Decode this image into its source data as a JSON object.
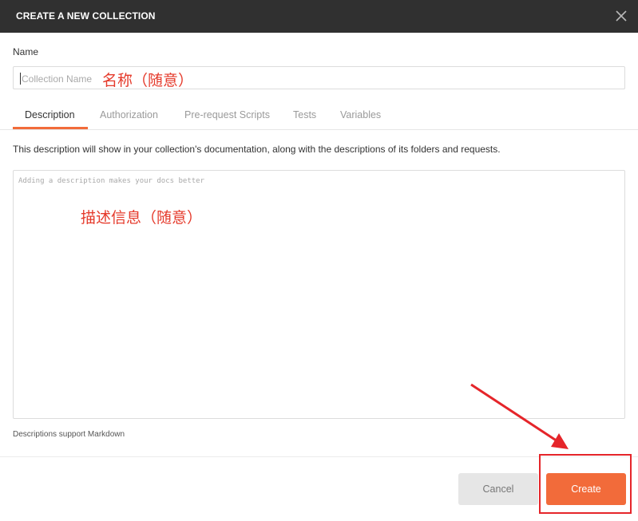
{
  "dialog": {
    "title": "CREATE A NEW COLLECTION",
    "close_icon": "close-icon"
  },
  "name": {
    "label": "Name",
    "placeholder": "Collection Name",
    "annotation": "名称（随意）"
  },
  "tabs": [
    {
      "label": "Description",
      "active": true
    },
    {
      "label": "Authorization",
      "active": false
    },
    {
      "label": "Pre-request Scripts",
      "active": false
    },
    {
      "label": "Tests",
      "active": false
    },
    {
      "label": "Variables",
      "active": false
    }
  ],
  "description": {
    "help_text": "This description will show in your collection's documentation, along with the descriptions of its folders and requests.",
    "placeholder": "Adding a description makes your docs better",
    "annotation": "描述信息（随意）",
    "markdown_note": "Descriptions support Markdown"
  },
  "footer": {
    "cancel_label": "Cancel",
    "create_label": "Create"
  },
  "colors": {
    "header_bg": "#303030",
    "accent": "#f26b3a",
    "annotation_red": "#e5252a"
  }
}
